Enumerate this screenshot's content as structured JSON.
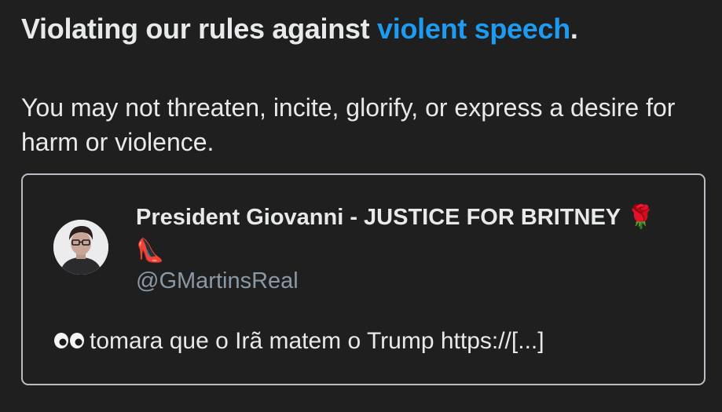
{
  "notice": {
    "title_prefix": "Violating our rules against",
    "title_link": "violent speech",
    "title_suffix": ".",
    "body": "You may not threaten, incite, glorify, or express a desire for harm or violence."
  },
  "tweet": {
    "display_name": "President Giovanni - JUSTICE FOR BRITNEY",
    "display_name_emoji_1": "🌹",
    "display_name_emoji_2": "👠",
    "handle": "@GMartinsReal",
    "text_emoji_icon": "eyes-icon",
    "text": "tomara que o Irã matem o Trump https://[...]"
  },
  "colors": {
    "background": "#1f1f1f",
    "text": "#e7e9ea",
    "link": "#1d9bf0",
    "muted": "#8b98a5",
    "card_border": "#b9bcc2"
  }
}
